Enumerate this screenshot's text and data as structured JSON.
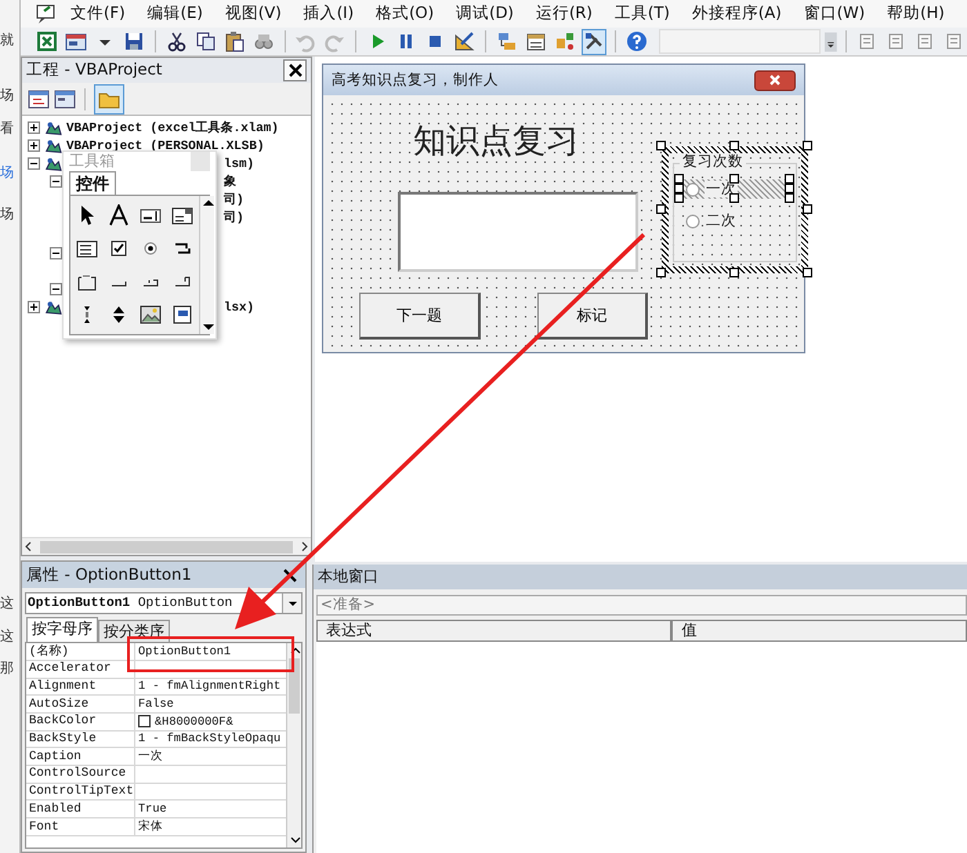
{
  "background_texts": [
    {
      "text": "就",
      "color": "#333333"
    },
    {
      "text": "场",
      "color": "#333333"
    },
    {
      "text": "看",
      "color": "#333333"
    },
    {
      "text": "场",
      "color": "#2a6fdb"
    },
    {
      "text": "场",
      "color": "#333333"
    },
    {
      "text": "这",
      "color": "#333333"
    },
    {
      "text": "这",
      "color": "#333333"
    },
    {
      "text": "那",
      "color": "#333333"
    }
  ],
  "menu": [
    {
      "label": "文件(F)"
    },
    {
      "label": "编辑(E)"
    },
    {
      "label": "视图(V)"
    },
    {
      "label": "插入(I)"
    },
    {
      "label": "格式(O)"
    },
    {
      "label": "调试(D)"
    },
    {
      "label": "运行(R)"
    },
    {
      "label": "工具(T)"
    },
    {
      "label": "外接程序(A)"
    },
    {
      "label": "窗口(W)"
    },
    {
      "label": "帮助(H)"
    }
  ],
  "toolbar": {
    "undo_disabled": true,
    "toolbox_pressed": true
  },
  "project": {
    "title": "工程 - VBAProject",
    "folders_pressed": true,
    "tree": [
      {
        "text": "VBAProject (excel工具条.xlam)",
        "expanded": false,
        "covered": false
      },
      {
        "text": "VBAProject (PERSONAL.XLSB)",
        "expanded": false,
        "covered": false
      },
      {
        "text": "lsm)",
        "expanded": true,
        "covered": true,
        "children": [
          {
            "text": "象",
            "expanded": true,
            "covered": true,
            "children": [
              {
                "text": "司)",
                "covered": true
              },
              {
                "text": "司)",
                "covered": true
              }
            ]
          },
          {
            "expanded": true
          },
          {
            "expanded": true
          }
        ]
      },
      {
        "text": "lsx)",
        "expanded": false,
        "covered": true
      }
    ]
  },
  "toolbox": {
    "title": "工具箱",
    "tab": "控件"
  },
  "form": {
    "title": "高考知识点复习，制作人",
    "heading": "知识点复习",
    "buttons": [
      "下一题",
      "标记"
    ],
    "frame": {
      "caption": "复习次数",
      "selected": true,
      "options": [
        {
          "label": "一次",
          "checked": false,
          "selected": true
        },
        {
          "label": "二次",
          "checked": false,
          "selected": false
        }
      ]
    }
  },
  "properties": {
    "title": "属性 - OptionButton1",
    "object_name": "OptionButton1",
    "object_type": "OptionButton",
    "tabs": [
      {
        "label": "按字母序",
        "selected": true
      },
      {
        "label": "按分类序",
        "selected": false
      }
    ],
    "rows": [
      {
        "name": "(名称)",
        "value": "OptionButton1"
      },
      {
        "name": "Accelerator"
      },
      {
        "name": "Alignment",
        "value": "1 - fmAlignmentRight"
      },
      {
        "name": "AutoSize",
        "value": "False"
      },
      {
        "name": "BackColor",
        "value": "&H8000000F&",
        "color": "#ffffff"
      },
      {
        "name": "BackStyle",
        "value": "1 - fmBackStyleOpaqu"
      },
      {
        "name": "Caption",
        "value": "一次"
      },
      {
        "name": "ControlSource"
      },
      {
        "name": "ControlTipText"
      },
      {
        "name": "Enabled",
        "value": "True"
      },
      {
        "name": "Font",
        "value": "宋体"
      }
    ]
  },
  "locals": {
    "title": "本地窗口",
    "context": "<准备>",
    "columns": [
      "表达式",
      "值"
    ]
  },
  "annotations": {
    "arrow": true,
    "highlight_box": true
  }
}
